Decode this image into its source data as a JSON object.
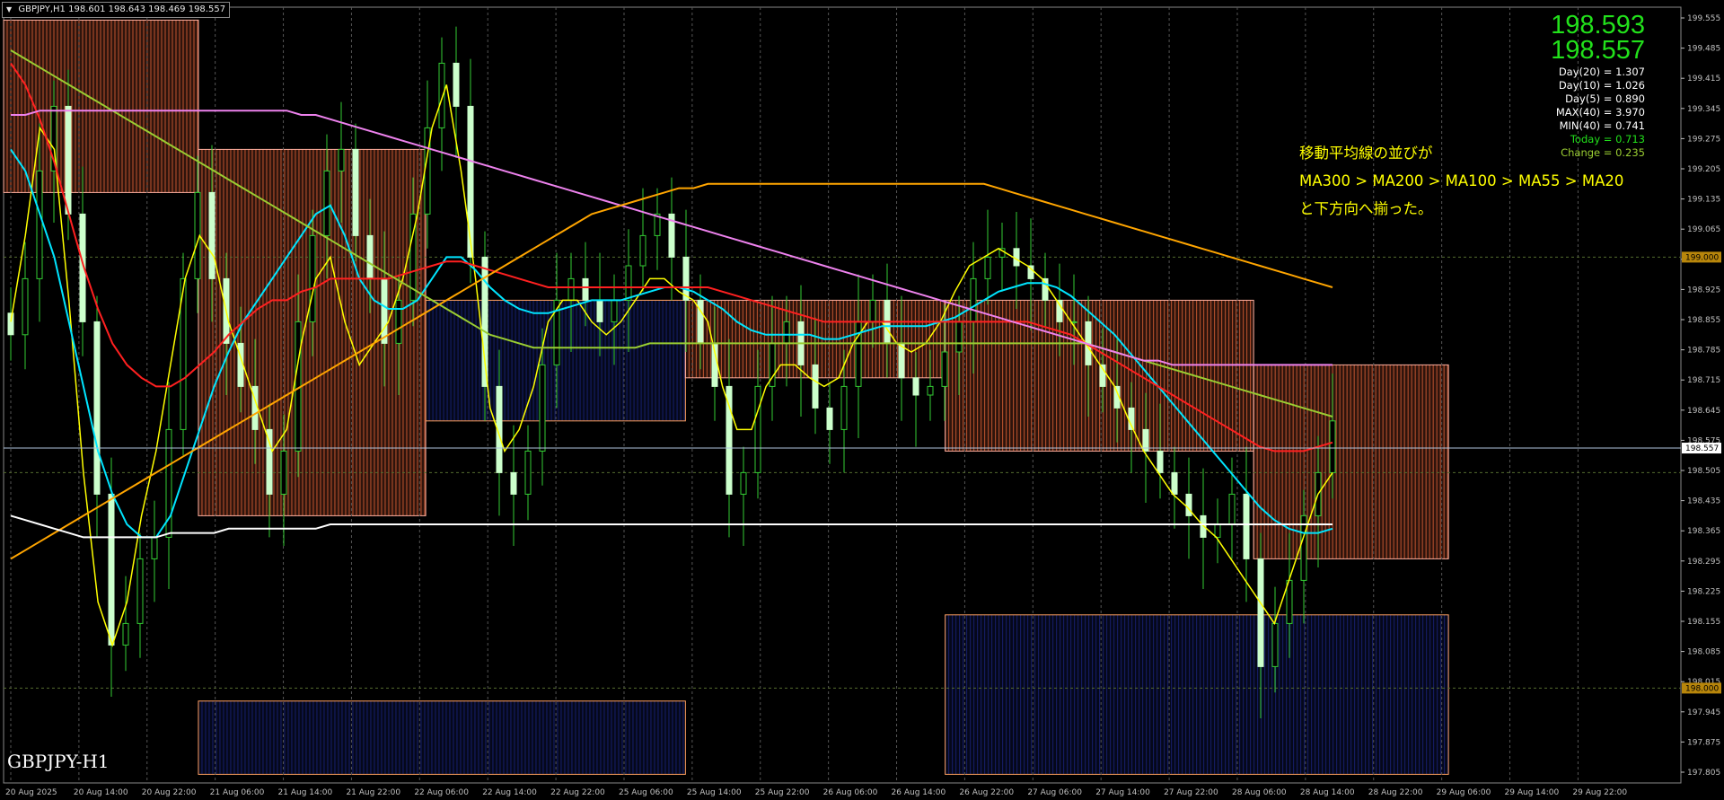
{
  "header": {
    "symbol": "GBPJPY,H1",
    "ohlc": "198.601 198.643 198.469 198.557"
  },
  "prices": {
    "bid": "198.593",
    "last": "198.557"
  },
  "stats": [
    {
      "text": "Day(20) = 1.307",
      "color": "#ffffff"
    },
    {
      "text": "Day(10) = 1.026",
      "color": "#ffffff"
    },
    {
      "text": "Day(5) = 0.890",
      "color": "#ffffff"
    },
    {
      "text": "MAX(40) = 3.970",
      "color": "#ffffff"
    },
    {
      "text": "MIN(40) = 0.741",
      "color": "#ffffff"
    },
    {
      "text": "Today = 0.713",
      "color": "#22e11b"
    },
    {
      "text": "Change = 0.235",
      "color": "#9acd32"
    }
  ],
  "annotation": {
    "line1": "移動平均線の並びが",
    "line2": "MA300 > MA200 > MA100 > MA55 > MA20",
    "line3": "と下方向へ揃った。"
  },
  "symbol_label": "GBPJPY-H1",
  "colors": {
    "bull": "#33cc33",
    "bear": "#ccffcc",
    "grid": "#555555",
    "axis": "#c0c0c0",
    "ma20": "#ffff00",
    "ma55": "#00e5ff",
    "ma100": "#ff2020",
    "ma200": "#9acd32",
    "ma300": "#ee82ee",
    "ma_long": "#ffa500",
    "ma_white": "#ffffff",
    "cloud_bull": "#1e2a90",
    "cloud_bear": "#ff7040"
  },
  "chart_data": {
    "type": "candlestick",
    "ylim": [
      197.78,
      199.58
    ],
    "y_ticks": [
      "199.555",
      "199.485",
      "199.415",
      "199.345",
      "199.275",
      "199.205",
      "199.135",
      "199.065",
      "198.995",
      "198.925",
      "198.855",
      "198.785",
      "198.715",
      "198.645",
      "198.575",
      "198.505",
      "198.435",
      "198.365",
      "198.295",
      "198.225",
      "198.155",
      "198.085",
      "198.015",
      "197.945",
      "197.875",
      "197.805"
    ],
    "price_tags": [
      {
        "label": "198.557",
        "value": 198.557,
        "bg": "#ffffff",
        "fg": "#000000"
      },
      {
        "label": "199.000",
        "value": 199.0,
        "bg": "#b8860b",
        "fg": "#000000"
      },
      {
        "label": "198.000",
        "value": 198.0,
        "bg": "#b8860b",
        "fg": "#000000"
      }
    ],
    "x_labels": [
      "20 Aug 2025",
      "20 Aug 14:00",
      "20 Aug 22:00",
      "21 Aug 06:00",
      "21 Aug 14:00",
      "21 Aug 22:00",
      "22 Aug 06:00",
      "22 Aug 14:00",
      "22 Aug 22:00",
      "25 Aug 06:00",
      "25 Aug 14:00",
      "25 Aug 22:00",
      "26 Aug 06:00",
      "26 Aug 14:00",
      "26 Aug 22:00",
      "27 Aug 06:00",
      "27 Aug 14:00",
      "27 Aug 22:00",
      "28 Aug 06:00",
      "28 Aug 14:00",
      "28 Aug 22:00",
      "29 Aug 06:00",
      "29 Aug 14:00",
      "29 Aug 22:00"
    ],
    "closes": [
      198.82,
      198.95,
      199.2,
      199.35,
      199.1,
      198.85,
      198.45,
      198.1,
      198.15,
      198.3,
      198.35,
      198.6,
      198.95,
      199.15,
      198.95,
      198.8,
      198.7,
      198.6,
      198.45,
      198.55,
      198.85,
      199.05,
      199.2,
      199.25,
      199.05,
      198.95,
      198.8,
      198.9,
      199.1,
      199.3,
      199.45,
      199.35,
      199.0,
      198.7,
      198.5,
      198.45,
      198.55,
      198.75,
      198.9,
      198.95,
      198.9,
      198.85,
      198.9,
      198.98,
      199.05,
      199.1,
      199.0,
      198.9,
      198.8,
      198.7,
      198.45,
      198.5,
      198.7,
      198.8,
      198.85,
      198.75,
      198.65,
      198.6,
      198.7,
      198.85,
      198.9,
      198.8,
      198.72,
      198.68,
      198.7,
      198.78,
      198.85,
      198.95,
      199.0,
      199.02,
      198.98,
      198.95,
      198.9,
      198.85,
      198.85,
      198.75,
      198.7,
      198.65,
      198.6,
      198.55,
      198.5,
      198.45,
      198.4,
      198.35,
      198.38,
      198.45,
      198.3,
      198.05,
      198.15,
      198.25,
      198.4,
      198.5,
      198.62
    ],
    "series": [
      {
        "name": "MA20",
        "color": "#ffff00",
        "values": [
          198.85,
          199.05,
          199.3,
          199.25,
          198.9,
          198.5,
          198.2,
          198.1,
          198.2,
          198.4,
          198.55,
          198.75,
          198.95,
          199.05,
          199.0,
          198.85,
          198.75,
          198.65,
          198.55,
          198.6,
          198.8,
          198.95,
          199.0,
          198.85,
          198.75,
          198.8,
          198.85,
          198.95,
          199.1,
          199.3,
          199.4,
          199.2,
          198.95,
          198.65,
          198.55,
          198.6,
          198.7,
          198.85,
          198.9,
          198.9,
          198.85,
          198.82,
          198.85,
          198.9,
          198.95,
          198.95,
          198.92,
          198.9,
          198.85,
          198.7,
          198.6,
          198.6,
          198.7,
          198.75,
          198.75,
          198.72,
          198.7,
          198.72,
          198.8,
          198.85,
          198.85,
          198.8,
          198.78,
          198.8,
          198.85,
          198.92,
          198.98,
          199.0,
          199.02,
          199.0,
          198.98,
          198.95,
          198.9,
          198.85,
          198.8,
          198.75,
          198.7,
          198.62,
          198.55,
          198.5,
          198.45,
          198.42,
          198.38,
          198.35,
          198.3,
          198.25,
          198.2,
          198.15,
          198.25,
          198.35,
          198.45,
          198.5
        ]
      },
      {
        "name": "MA55",
        "color": "#00e5ff",
        "values": [
          199.25,
          199.2,
          199.1,
          199.0,
          198.85,
          198.7,
          198.55,
          198.45,
          198.38,
          198.35,
          198.35,
          198.4,
          198.5,
          198.6,
          198.7,
          198.78,
          198.85,
          198.9,
          198.95,
          199.0,
          199.05,
          199.1,
          199.12,
          199.05,
          198.95,
          198.9,
          198.88,
          198.88,
          198.9,
          198.95,
          199.0,
          199.0,
          198.97,
          198.93,
          198.9,
          198.88,
          198.87,
          198.87,
          198.88,
          198.89,
          198.9,
          198.9,
          198.9,
          198.91,
          198.92,
          198.93,
          198.93,
          198.92,
          198.9,
          198.88,
          198.85,
          198.83,
          198.82,
          198.82,
          198.82,
          198.82,
          198.81,
          198.81,
          198.82,
          198.83,
          198.84,
          198.84,
          198.84,
          198.84,
          198.85,
          198.86,
          198.88,
          198.9,
          198.92,
          198.93,
          198.94,
          198.94,
          198.93,
          198.91,
          198.88,
          198.85,
          198.82,
          198.78,
          198.74,
          198.7,
          198.66,
          198.62,
          198.58,
          198.54,
          198.5,
          198.46,
          198.42,
          198.39,
          198.37,
          198.36,
          198.36,
          198.37
        ]
      },
      {
        "name": "MA100",
        "color": "#ff2020",
        "values": [
          199.45,
          199.4,
          199.32,
          199.22,
          199.1,
          198.98,
          198.88,
          198.8,
          198.75,
          198.72,
          198.7,
          198.7,
          198.72,
          198.75,
          198.78,
          198.82,
          198.85,
          198.88,
          198.9,
          198.9,
          198.92,
          198.93,
          198.95,
          198.95,
          198.95,
          198.95,
          198.95,
          198.96,
          198.97,
          198.98,
          198.99,
          198.99,
          198.98,
          198.97,
          198.96,
          198.95,
          198.94,
          198.93,
          198.93,
          198.93,
          198.93,
          198.93,
          198.93,
          198.93,
          198.93,
          198.93,
          198.93,
          198.93,
          198.93,
          198.92,
          198.91,
          198.9,
          198.89,
          198.88,
          198.87,
          198.86,
          198.85,
          198.85,
          198.85,
          198.85,
          198.85,
          198.85,
          198.85,
          198.85,
          198.85,
          198.85,
          198.85,
          198.85,
          198.85,
          198.85,
          198.85,
          198.84,
          198.83,
          198.82,
          198.8,
          198.78,
          198.76,
          198.74,
          198.72,
          198.7,
          198.68,
          198.66,
          198.64,
          198.62,
          198.6,
          198.58,
          198.56,
          198.55,
          198.55,
          198.55,
          198.56,
          198.57
        ]
      },
      {
        "name": "MA200",
        "color": "#9acd32",
        "values": [
          199.48,
          199.46,
          199.44,
          199.42,
          199.4,
          199.38,
          199.36,
          199.34,
          199.32,
          199.3,
          199.28,
          199.26,
          199.24,
          199.22,
          199.2,
          199.18,
          199.16,
          199.14,
          199.12,
          199.1,
          199.08,
          199.06,
          199.04,
          199.02,
          199.0,
          198.98,
          198.96,
          198.94,
          198.92,
          198.9,
          198.88,
          198.86,
          198.84,
          198.82,
          198.81,
          198.8,
          198.79,
          198.79,
          198.79,
          198.79,
          198.79,
          198.79,
          198.79,
          198.79,
          198.8,
          198.8,
          198.8,
          198.8,
          198.8,
          198.8,
          198.8,
          198.8,
          198.8,
          198.8,
          198.8,
          198.8,
          198.8,
          198.8,
          198.8,
          198.8,
          198.8,
          198.8,
          198.8,
          198.8,
          198.8,
          198.8,
          198.8,
          198.8,
          198.8,
          198.8,
          198.8,
          198.8,
          198.8,
          198.8,
          198.8,
          198.79,
          198.78,
          198.77,
          198.76,
          198.75,
          198.74,
          198.73,
          198.72,
          198.71,
          198.7,
          198.69,
          198.68,
          198.67,
          198.66,
          198.65,
          198.64,
          198.63
        ]
      },
      {
        "name": "MA300",
        "color": "#ee82ee",
        "values": [
          199.33,
          199.33,
          199.34,
          199.34,
          199.34,
          199.34,
          199.34,
          199.34,
          199.34,
          199.34,
          199.34,
          199.34,
          199.34,
          199.34,
          199.34,
          199.34,
          199.34,
          199.34,
          199.34,
          199.34,
          199.33,
          199.33,
          199.32,
          199.31,
          199.3,
          199.29,
          199.28,
          199.27,
          199.26,
          199.25,
          199.24,
          199.23,
          199.22,
          199.21,
          199.2,
          199.19,
          199.18,
          199.17,
          199.16,
          199.15,
          199.14,
          199.13,
          199.12,
          199.11,
          199.1,
          199.09,
          199.08,
          199.07,
          199.06,
          199.05,
          199.04,
          199.03,
          199.02,
          199.01,
          199.0,
          198.99,
          198.98,
          198.97,
          198.96,
          198.95,
          198.94,
          198.93,
          198.92,
          198.91,
          198.9,
          198.89,
          198.88,
          198.87,
          198.86,
          198.85,
          198.84,
          198.83,
          198.82,
          198.81,
          198.8,
          198.79,
          198.78,
          198.77,
          198.76,
          198.76,
          198.75,
          198.75,
          198.75,
          198.75,
          198.75,
          198.75,
          198.75,
          198.75,
          198.75,
          198.75,
          198.75,
          198.75
        ]
      },
      {
        "name": "MA-orange",
        "color": "#ffa500",
        "values": [
          198.3,
          198.32,
          198.34,
          198.36,
          198.38,
          198.4,
          198.42,
          198.44,
          198.46,
          198.48,
          198.5,
          198.52,
          198.54,
          198.56,
          198.58,
          198.6,
          198.62,
          198.64,
          198.66,
          198.68,
          198.7,
          198.72,
          198.74,
          198.76,
          198.78,
          198.8,
          198.82,
          198.84,
          198.86,
          198.88,
          198.9,
          198.92,
          198.94,
          198.96,
          198.98,
          199.0,
          199.02,
          199.04,
          199.06,
          199.08,
          199.1,
          199.11,
          199.12,
          199.13,
          199.14,
          199.15,
          199.16,
          199.16,
          199.17,
          199.17,
          199.17,
          199.17,
          199.17,
          199.17,
          199.17,
          199.17,
          199.17,
          199.17,
          199.17,
          199.17,
          199.17,
          199.17,
          199.17,
          199.17,
          199.17,
          199.17,
          199.17,
          199.17,
          199.16,
          199.15,
          199.14,
          199.13,
          199.12,
          199.11,
          199.1,
          199.09,
          199.08,
          199.07,
          199.06,
          199.05,
          199.04,
          199.03,
          199.02,
          199.01,
          199.0,
          198.99,
          198.98,
          198.97,
          198.96,
          198.95,
          198.94,
          198.93
        ]
      },
      {
        "name": "MA-white",
        "color": "#ffffff",
        "values": [
          198.4,
          198.39,
          198.38,
          198.37,
          198.36,
          198.35,
          198.35,
          198.35,
          198.35,
          198.35,
          198.35,
          198.36,
          198.36,
          198.36,
          198.36,
          198.37,
          198.37,
          198.37,
          198.37,
          198.37,
          198.37,
          198.37,
          198.38,
          198.38,
          198.38,
          198.38,
          198.38,
          198.38,
          198.38,
          198.38,
          198.38,
          198.38,
          198.38,
          198.38,
          198.38,
          198.38,
          198.38,
          198.38,
          198.38,
          198.38,
          198.38,
          198.38,
          198.38,
          198.38,
          198.38,
          198.38,
          198.38,
          198.38,
          198.38,
          198.38,
          198.38,
          198.38,
          198.38,
          198.38,
          198.38,
          198.38,
          198.38,
          198.38,
          198.38,
          198.38,
          198.38,
          198.38,
          198.38,
          198.38,
          198.38,
          198.38,
          198.38,
          198.38,
          198.38,
          198.38,
          198.38,
          198.38,
          198.38,
          198.38,
          198.38,
          198.38,
          198.38,
          198.38,
          198.38,
          198.38,
          198.38,
          198.38,
          198.38,
          198.38,
          198.38,
          198.38,
          198.38,
          198.38,
          198.38,
          198.38,
          198.38,
          198.38
        ]
      }
    ],
    "cloud": [
      {
        "from": 0.0,
        "to": 0.12,
        "top": 199.55,
        "bot": 199.15,
        "kind": "bear"
      },
      {
        "from": 0.12,
        "to": 0.26,
        "top": 199.25,
        "bot": 198.4,
        "kind": "bear"
      },
      {
        "from": 0.26,
        "to": 0.42,
        "top": 198.9,
        "bot": 198.62,
        "kind": "bull"
      },
      {
        "from": 0.42,
        "to": 0.58,
        "top": 198.9,
        "bot": 198.72,
        "kind": "bear"
      },
      {
        "from": 0.58,
        "to": 0.77,
        "top": 198.9,
        "bot": 198.55,
        "kind": "bear"
      },
      {
        "from": 0.77,
        "to": 0.89,
        "top": 198.75,
        "bot": 198.3,
        "kind": "bear"
      },
      {
        "from": 0.58,
        "to": 0.89,
        "top": 198.17,
        "bot": 197.8,
        "kind": "bull"
      },
      {
        "from": 0.12,
        "to": 0.42,
        "top": 197.97,
        "bot": 197.8,
        "kind": "bull"
      }
    ]
  }
}
